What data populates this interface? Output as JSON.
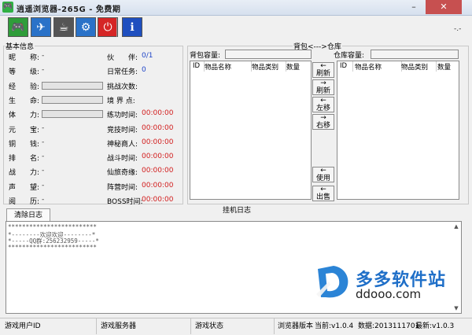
{
  "window": {
    "title": "逍遥浏览器-265G - 免费期",
    "minimize": "–",
    "close": "✕"
  },
  "toolbar": {
    "buttons": [
      {
        "name": "gamepad",
        "icon": "gamepad-icon",
        "color": "#2f9d3a",
        "glyph": "🎮"
      },
      {
        "name": "plane",
        "icon": "airplane-icon",
        "color": "#2a72c8",
        "glyph": "✈"
      },
      {
        "name": "cup",
        "icon": "mug-icon",
        "color": "#555555",
        "glyph": "☕"
      },
      {
        "name": "settings",
        "icon": "window-gear-icon",
        "color": "#2a72c8",
        "glyph": "⚙"
      },
      {
        "name": "power",
        "icon": "power-icon",
        "color": "#d52626",
        "glyph": "⏻"
      },
      {
        "name": "about",
        "icon": "info-icon",
        "color": "#1f4fbf",
        "glyph": "ℹ"
      }
    ],
    "right_marker": "-.-"
  },
  "basic_info": {
    "title": "基本信息",
    "left_rows": [
      {
        "label": "昵　　称:",
        "value": "-",
        "type": "text"
      },
      {
        "label": "等　　级:",
        "value": "-",
        "type": "text"
      },
      {
        "label": "经　　验:",
        "value": "",
        "type": "bar"
      },
      {
        "label": "生　　命:",
        "value": "",
        "type": "bar"
      },
      {
        "label": "体　　力:",
        "value": "",
        "type": "bar"
      },
      {
        "label": "元　　宝:",
        "value": "-",
        "type": "text"
      },
      {
        "label": "铜　　钱:",
        "value": "-",
        "type": "text"
      },
      {
        "label": "排　　名:",
        "value": "-",
        "type": "text"
      },
      {
        "label": "战　　力:",
        "value": "-",
        "type": "text"
      },
      {
        "label": "声　　望:",
        "value": "-",
        "type": "text"
      },
      {
        "label": "阅　　历:",
        "value": "-",
        "type": "text"
      }
    ],
    "right_rows": [
      {
        "label": "伙　　伴:",
        "value": "0/1",
        "color": "blue"
      },
      {
        "label": "日常任务:",
        "value": "0",
        "color": "blue"
      },
      {
        "label": "挑战次数:",
        "value": "",
        "color": "red"
      },
      {
        "label": "境 界 点:",
        "value": "",
        "color": "red"
      },
      {
        "label": "练功时间:",
        "value": "00:00:00",
        "color": "red"
      },
      {
        "label": "竞技时间:",
        "value": "00:00:00",
        "color": "red"
      },
      {
        "label": "神秘商人:",
        "value": "00:00:00",
        "color": "red"
      },
      {
        "label": "战斗时间:",
        "value": "00:00:00",
        "color": "red"
      },
      {
        "label": "仙旅奇缘:",
        "value": "00:00:00",
        "color": "red"
      },
      {
        "label": "阵营时间:",
        "value": "00:00:00",
        "color": "red"
      },
      {
        "label": "BOSS时间:",
        "value": "00:00:00",
        "color": "red"
      }
    ]
  },
  "bag_warehouse": {
    "title": "背包<--->仓库",
    "bag_capacity_label": "背包容量:",
    "warehouse_capacity_label": "仓库容量:",
    "bag_columns": [
      "ID",
      "物品名称",
      "物品类别",
      "数量"
    ],
    "warehouse_columns": [
      "ID",
      "物品名称",
      "物品类别",
      "数量"
    ],
    "move_buttons": [
      {
        "arrow": "←",
        "label": "刷新"
      },
      {
        "arrow": "→",
        "label": "刷新"
      },
      {
        "arrow": "←",
        "label": "左移"
      },
      {
        "arrow": "→",
        "label": "右移"
      },
      {
        "arrow": "←",
        "label": "使用"
      },
      {
        "arrow": "←",
        "label": "出售"
      }
    ]
  },
  "log": {
    "section_title": "挂机日志",
    "clear_tab": "清除日志",
    "lines": [
      "*************************",
      "*--------欢迎欢迎--------*",
      "*-----QQ群:256232959-----*",
      "*************************"
    ]
  },
  "status_bar": {
    "user_id": "游戏用户ID",
    "server": "游戏服务器",
    "state": "游戏状态",
    "browser_version": "浏览器版本",
    "current": "当前:v1.0.4",
    "data": "数据:2013111701",
    "latest": "最新:v1.0.3"
  },
  "watermark": {
    "logo_letter": "D",
    "cn_name": "多多软件站",
    "domain": "ddooo.com"
  }
}
